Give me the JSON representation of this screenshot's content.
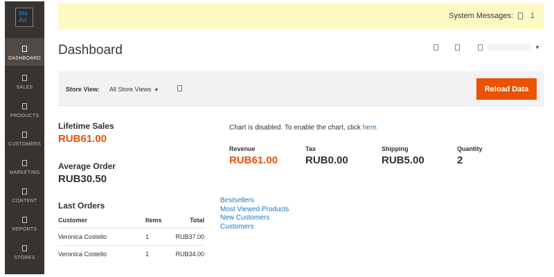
{
  "sidebar": {
    "logo_alt": "Ma Ad",
    "items": [
      {
        "label": "DASHBOARD",
        "active": true
      },
      {
        "label": "SALES"
      },
      {
        "label": "PRODUCTS"
      },
      {
        "label": "CUSTOMERS"
      },
      {
        "label": "MARKETING"
      },
      {
        "label": "CONTENT"
      },
      {
        "label": "REPORTS"
      },
      {
        "label": "STORES"
      }
    ]
  },
  "system_messages": {
    "label": "System Messages:",
    "count": "1"
  },
  "header": {
    "title": "Dashboard"
  },
  "store_view": {
    "label": "Store View:",
    "selected": "All Store Views",
    "reload_label": "Reload Data"
  },
  "stats": {
    "lifetime_sales_label": "Lifetime Sales",
    "lifetime_sales_value": "RUB61.00",
    "average_order_label": "Average Order",
    "average_order_value": "RUB30.50"
  },
  "last_orders": {
    "title": "Last Orders",
    "columns": [
      "Customer",
      "Items",
      "Total"
    ],
    "rows": [
      [
        "Veronica Costello",
        "1",
        "RUB37.00"
      ],
      [
        "Veronica Costello",
        "1",
        "RUB34.00"
      ]
    ]
  },
  "chart": {
    "message": "Chart is disabled. To enable the chart, click",
    "link": "here."
  },
  "totals": [
    {
      "label": "Revenue",
      "value": "RUB61.00"
    },
    {
      "label": "Tax",
      "value": "RUB0.00"
    },
    {
      "label": "Shipping",
      "value": "RUB5.00"
    },
    {
      "label": "Quantity",
      "value": "2"
    }
  ],
  "tabs": [
    "Bestsellers",
    "Most Viewed Products",
    "New Customers",
    "Customers"
  ],
  "colors": {
    "accent": "#eb5202",
    "sidebar": "#373330",
    "link": "#1979c3",
    "notice": "#fdf9c3"
  }
}
